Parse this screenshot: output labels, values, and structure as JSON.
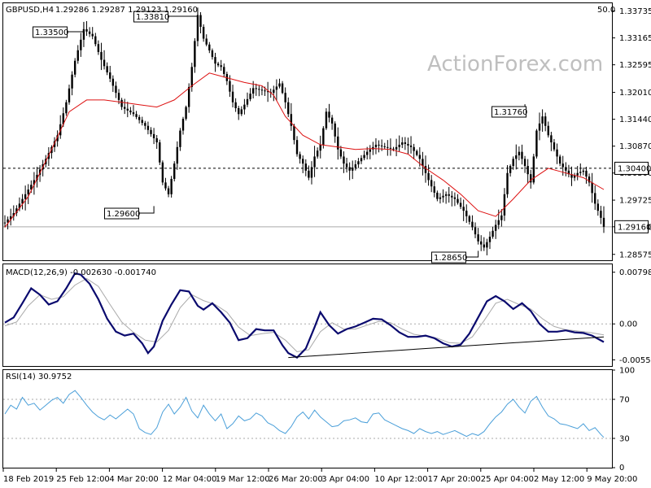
{
  "header": {
    "symbol": "GBPUSD,H4",
    "ohlc": "1.29286 1.29287 1.29123 1.29160",
    "corner_value": "50.0"
  },
  "watermark": "ActionForex.com",
  "colors": {
    "candles": "#000000",
    "ma": "#dd1111",
    "macd": "#0a0a6e",
    "signal": "#aaaaaa",
    "rsi": "#4a9fd9",
    "trend": "#000000",
    "grid": "#aaaaaa"
  },
  "chart_data": [
    {
      "type": "candlestick",
      "yticks": [
        "1.33735",
        "1.33165",
        "1.32595",
        "1.32010",
        "1.31440",
        "1.30870",
        "1.30300",
        "1.29725",
        "1.29160",
        "1.28575"
      ],
      "ylim": [
        1.2845,
        1.339
      ],
      "reference_line": "1.30400",
      "current_price": "1.29160",
      "annotations": [
        "1.33500",
        "1.33810",
        "1.29600",
        "1.31760",
        "1.28650"
      ],
      "price_series": [
        [
          0,
          1.2925
        ],
        [
          3,
          1.2945
        ],
        [
          6,
          1.2975
        ],
        [
          10,
          1.3015
        ],
        [
          14,
          1.306
        ],
        [
          18,
          1.311
        ],
        [
          21,
          1.318
        ],
        [
          24,
          1.3268
        ],
        [
          27,
          1.3335
        ],
        [
          30,
          1.332
        ],
        [
          33,
          1.327
        ],
        [
          36,
          1.323
        ],
        [
          40,
          1.317
        ],
        [
          44,
          1.3155
        ],
        [
          48,
          1.313
        ],
        [
          52,
          1.3095
        ],
        [
          54,
          1.301
        ],
        [
          56,
          1.2985
        ],
        [
          58,
          1.305
        ],
        [
          60,
          1.312
        ],
        [
          62,
          1.317
        ],
        [
          64,
          1.3255
        ],
        [
          66,
          1.3365
        ],
        [
          68,
          1.3315
        ],
        [
          70,
          1.329
        ],
        [
          72,
          1.3262
        ],
        [
          74,
          1.3255
        ],
        [
          76,
          1.3225
        ],
        [
          78,
          1.318
        ],
        [
          80,
          1.3155
        ],
        [
          82,
          1.3175
        ],
        [
          85,
          1.321
        ],
        [
          88,
          1.3205
        ],
        [
          91,
          1.32
        ],
        [
          94,
          1.322
        ],
        [
          96,
          1.318
        ],
        [
          98,
          1.313
        ],
        [
          100,
          1.307
        ],
        [
          102,
          1.305
        ],
        [
          104,
          1.302
        ],
        [
          106,
          1.3065
        ],
        [
          108,
          1.309
        ],
        [
          110,
          1.316
        ],
        [
          112,
          1.3135
        ],
        [
          114,
          1.308
        ],
        [
          116,
          1.305
        ],
        [
          118,
          1.3035
        ],
        [
          121,
          1.3055
        ],
        [
          124,
          1.3075
        ],
        [
          127,
          1.309
        ],
        [
          130,
          1.3085
        ],
        [
          133,
          1.308
        ],
        [
          136,
          1.3095
        ],
        [
          139,
          1.3085
        ],
        [
          142,
          1.306
        ],
        [
          145,
          1.3015
        ],
        [
          148,
          1.2975
        ],
        [
          151,
          1.2985
        ],
        [
          154,
          1.2975
        ],
        [
          157,
          1.295
        ],
        [
          160,
          1.2915
        ],
        [
          162,
          1.2885
        ],
        [
          164,
          1.2872
        ],
        [
          166,
          1.2895
        ],
        [
          168,
          1.292
        ],
        [
          170,
          1.294
        ],
        [
          172,
          1.303
        ],
        [
          174,
          1.306
        ],
        [
          176,
          1.3075
        ],
        [
          178,
          1.3045
        ],
        [
          180,
          1.301
        ],
        [
          182,
          1.312
        ],
        [
          184,
          1.315
        ],
        [
          186,
          1.311
        ],
        [
          188,
          1.308
        ],
        [
          190,
          1.305
        ],
        [
          192,
          1.3035
        ],
        [
          194,
          1.302
        ],
        [
          196,
          1.303
        ],
        [
          198,
          1.3035
        ],
        [
          200,
          1.301
        ],
        [
          202,
          1.2965
        ],
        [
          204,
          1.2935
        ],
        [
          205,
          1.2916
        ]
      ],
      "moving_average": [
        [
          0,
          1.2915
        ],
        [
          8,
          1.298
        ],
        [
          16,
          1.308
        ],
        [
          22,
          1.316
        ],
        [
          28,
          1.3185
        ],
        [
          34,
          1.3185
        ],
        [
          40,
          1.318
        ],
        [
          46,
          1.3175
        ],
        [
          52,
          1.317
        ],
        [
          58,
          1.3185
        ],
        [
          64,
          1.3215
        ],
        [
          70,
          1.3242
        ],
        [
          76,
          1.3232
        ],
        [
          82,
          1.3222
        ],
        [
          88,
          1.3215
        ],
        [
          92,
          1.3195
        ],
        [
          96,
          1.315
        ],
        [
          102,
          1.311
        ],
        [
          108,
          1.309
        ],
        [
          114,
          1.3085
        ],
        [
          120,
          1.308
        ],
        [
          126,
          1.3082
        ],
        [
          132,
          1.308
        ],
        [
          138,
          1.307
        ],
        [
          144,
          1.304
        ],
        [
          150,
          1.3015
        ],
        [
          156,
          1.2985
        ],
        [
          162,
          1.295
        ],
        [
          168,
          1.2938
        ],
        [
          174,
          1.2975
        ],
        [
          180,
          1.3015
        ],
        [
          186,
          1.304
        ],
        [
          192,
          1.303
        ],
        [
          198,
          1.302
        ],
        [
          205,
          1.2995
        ]
      ]
    },
    {
      "type": "line",
      "name": "MACD(12,26,9) -0.002630 -0.001740",
      "yticks": [
        "0.007983",
        "0.00",
        "-0.005559"
      ],
      "ylim": [
        -0.0065,
        0.0092
      ],
      "macd": [
        [
          0,
          0.0002
        ],
        [
          3,
          0.001
        ],
        [
          6,
          0.0032
        ],
        [
          9,
          0.0055
        ],
        [
          12,
          0.0045
        ],
        [
          15,
          0.003
        ],
        [
          18,
          0.0035
        ],
        [
          21,
          0.0055
        ],
        [
          24,
          0.0078
        ],
        [
          26,
          0.0076
        ],
        [
          29,
          0.0062
        ],
        [
          32,
          0.0038
        ],
        [
          35,
          0.0008
        ],
        [
          38,
          -0.0012
        ],
        [
          41,
          -0.0018
        ],
        [
          44,
          -0.0015
        ],
        [
          47,
          -0.003
        ],
        [
          49,
          -0.0045
        ],
        [
          51,
          -0.0035
        ],
        [
          54,
          0.0005
        ],
        [
          57,
          0.003
        ],
        [
          60,
          0.0052
        ],
        [
          63,
          0.005
        ],
        [
          66,
          0.0028
        ],
        [
          68,
          0.0022
        ],
        [
          71,
          0.0032
        ],
        [
          74,
          0.0018
        ],
        [
          77,
          0.0002
        ],
        [
          80,
          -0.0025
        ],
        [
          83,
          -0.0022
        ],
        [
          86,
          -0.0008
        ],
        [
          89,
          -0.001
        ],
        [
          92,
          -0.001
        ],
        [
          95,
          -0.0033
        ],
        [
          97,
          -0.0045
        ],
        [
          100,
          -0.0052
        ],
        [
          103,
          -0.0038
        ],
        [
          106,
          -0.0005
        ],
        [
          108,
          0.0018
        ],
        [
          111,
          -0.0002
        ],
        [
          114,
          -0.0015
        ],
        [
          117,
          -0.0008
        ],
        [
          120,
          -0.0004
        ],
        [
          123,
          0.0002
        ],
        [
          126,
          0.0008
        ],
        [
          129,
          0.0007
        ],
        [
          132,
          -0.0002
        ],
        [
          135,
          -0.0013
        ],
        [
          138,
          -0.002
        ],
        [
          141,
          -0.002
        ],
        [
          144,
          -0.0018
        ],
        [
          147,
          -0.0022
        ],
        [
          150,
          -0.003
        ],
        [
          153,
          -0.0035
        ],
        [
          156,
          -0.0032
        ],
        [
          159,
          -0.0015
        ],
        [
          162,
          0.001
        ],
        [
          165,
          0.0035
        ],
        [
          168,
          0.0043
        ],
        [
          171,
          0.0035
        ],
        [
          174,
          0.0023
        ],
        [
          177,
          0.0032
        ],
        [
          180,
          0.002
        ],
        [
          183,
          0.0
        ],
        [
          186,
          -0.0012
        ],
        [
          189,
          -0.0012
        ],
        [
          192,
          -0.001
        ],
        [
          195,
          -0.0013
        ],
        [
          198,
          -0.0014
        ],
        [
          201,
          -0.0018
        ],
        [
          205,
          -0.0028
        ]
      ],
      "signal": [
        [
          0,
          -0.0003
        ],
        [
          4,
          0.0003
        ],
        [
          8,
          0.0028
        ],
        [
          12,
          0.0045
        ],
        [
          16,
          0.0038
        ],
        [
          20,
          0.0042
        ],
        [
          24,
          0.006
        ],
        [
          28,
          0.007
        ],
        [
          32,
          0.0058
        ],
        [
          36,
          0.003
        ],
        [
          40,
          0.0003
        ],
        [
          44,
          -0.0013
        ],
        [
          48,
          -0.0025
        ],
        [
          52,
          -0.0028
        ],
        [
          56,
          -0.001
        ],
        [
          60,
          0.0025
        ],
        [
          64,
          0.0045
        ],
        [
          68,
          0.0036
        ],
        [
          72,
          0.003
        ],
        [
          76,
          0.0018
        ],
        [
          80,
          -0.0005
        ],
        [
          84,
          -0.0018
        ],
        [
          88,
          -0.0015
        ],
        [
          92,
          -0.0013
        ],
        [
          96,
          -0.0025
        ],
        [
          100,
          -0.0043
        ],
        [
          104,
          -0.004
        ],
        [
          108,
          -0.0012
        ],
        [
          112,
          0.0002
        ],
        [
          116,
          -0.0008
        ],
        [
          120,
          -0.0008
        ],
        [
          124,
          -0.0002
        ],
        [
          128,
          0.0004
        ],
        [
          132,
          0.0002
        ],
        [
          136,
          -0.0008
        ],
        [
          140,
          -0.0016
        ],
        [
          144,
          -0.0019
        ],
        [
          148,
          -0.0022
        ],
        [
          152,
          -0.0029
        ],
        [
          156,
          -0.003
        ],
        [
          160,
          -0.002
        ],
        [
          164,
          0.0005
        ],
        [
          168,
          0.0032
        ],
        [
          172,
          0.0038
        ],
        [
          176,
          0.003
        ],
        [
          180,
          0.0023
        ],
        [
          184,
          0.0008
        ],
        [
          188,
          -0.0004
        ],
        [
          192,
          -0.0009
        ],
        [
          196,
          -0.0011
        ],
        [
          200,
          -0.0013
        ],
        [
          205,
          -0.0017
        ]
      ],
      "trendline": [
        [
          97,
          -0.0052
        ],
        [
          205,
          -0.002
        ]
      ]
    },
    {
      "type": "line",
      "name": "RSI(14) 30.9752",
      "yticks": [
        "100",
        "70",
        "30",
        "0"
      ],
      "ylim": [
        0,
        100
      ],
      "levels": [
        70,
        30
      ],
      "values": [
        [
          0,
          55
        ],
        [
          2,
          64
        ],
        [
          4,
          60
        ],
        [
          6,
          72
        ],
        [
          8,
          64
        ],
        [
          10,
          66
        ],
        [
          12,
          59
        ],
        [
          14,
          64
        ],
        [
          16,
          69
        ],
        [
          18,
          72
        ],
        [
          20,
          66
        ],
        [
          22,
          75
        ],
        [
          24,
          79
        ],
        [
          26,
          72
        ],
        [
          28,
          64
        ],
        [
          30,
          57
        ],
        [
          32,
          52
        ],
        [
          34,
          49
        ],
        [
          36,
          54
        ],
        [
          38,
          50
        ],
        [
          40,
          55
        ],
        [
          42,
          60
        ],
        [
          44,
          55
        ],
        [
          46,
          40
        ],
        [
          48,
          36
        ],
        [
          50,
          34
        ],
        [
          52,
          41
        ],
        [
          54,
          57
        ],
        [
          56,
          65
        ],
        [
          58,
          55
        ],
        [
          60,
          62
        ],
        [
          62,
          72
        ],
        [
          64,
          58
        ],
        [
          66,
          51
        ],
        [
          68,
          64
        ],
        [
          70,
          55
        ],
        [
          72,
          48
        ],
        [
          74,
          55
        ],
        [
          76,
          40
        ],
        [
          78,
          45
        ],
        [
          80,
          53
        ],
        [
          82,
          48
        ],
        [
          84,
          50
        ],
        [
          86,
          56
        ],
        [
          88,
          53
        ],
        [
          90,
          46
        ],
        [
          92,
          43
        ],
        [
          94,
          38
        ],
        [
          96,
          35
        ],
        [
          98,
          42
        ],
        [
          100,
          52
        ],
        [
          102,
          57
        ],
        [
          104,
          50
        ],
        [
          106,
          59
        ],
        [
          108,
          52
        ],
        [
          110,
          47
        ],
        [
          112,
          42
        ],
        [
          114,
          43
        ],
        [
          116,
          48
        ],
        [
          118,
          49
        ],
        [
          120,
          51
        ],
        [
          122,
          47
        ],
        [
          124,
          46
        ],
        [
          126,
          55
        ],
        [
          128,
          56
        ],
        [
          130,
          49
        ],
        [
          132,
          46
        ],
        [
          134,
          43
        ],
        [
          136,
          40
        ],
        [
          138,
          38
        ],
        [
          140,
          35
        ],
        [
          142,
          40
        ],
        [
          144,
          37
        ],
        [
          146,
          35
        ],
        [
          148,
          37
        ],
        [
          150,
          34
        ],
        [
          152,
          36
        ],
        [
          154,
          38
        ],
        [
          156,
          35
        ],
        [
          158,
          32
        ],
        [
          160,
          35
        ],
        [
          162,
          33
        ],
        [
          164,
          37
        ],
        [
          166,
          45
        ],
        [
          168,
          52
        ],
        [
          170,
          57
        ],
        [
          172,
          65
        ],
        [
          174,
          70
        ],
        [
          176,
          62
        ],
        [
          178,
          56
        ],
        [
          180,
          68
        ],
        [
          182,
          73
        ],
        [
          184,
          62
        ],
        [
          186,
          53
        ],
        [
          188,
          50
        ],
        [
          190,
          45
        ],
        [
          192,
          44
        ],
        [
          194,
          42
        ],
        [
          196,
          40
        ],
        [
          198,
          45
        ],
        [
          200,
          38
        ],
        [
          202,
          41
        ],
        [
          204,
          34
        ],
        [
          205,
          31
        ]
      ]
    }
  ],
  "x_axis": {
    "labels": [
      "18 Feb 2019",
      "25 Feb 12:00",
      "4 Mar 20:00",
      "12 Mar 04:00",
      "19 Mar 12:00",
      "26 Mar 20:00",
      "3 Apr 04:00",
      "10 Apr 12:00",
      "17 Apr 20:00",
      "25 Apr 04:00",
      "2 May 12:00",
      "9 May 20:00"
    ]
  }
}
